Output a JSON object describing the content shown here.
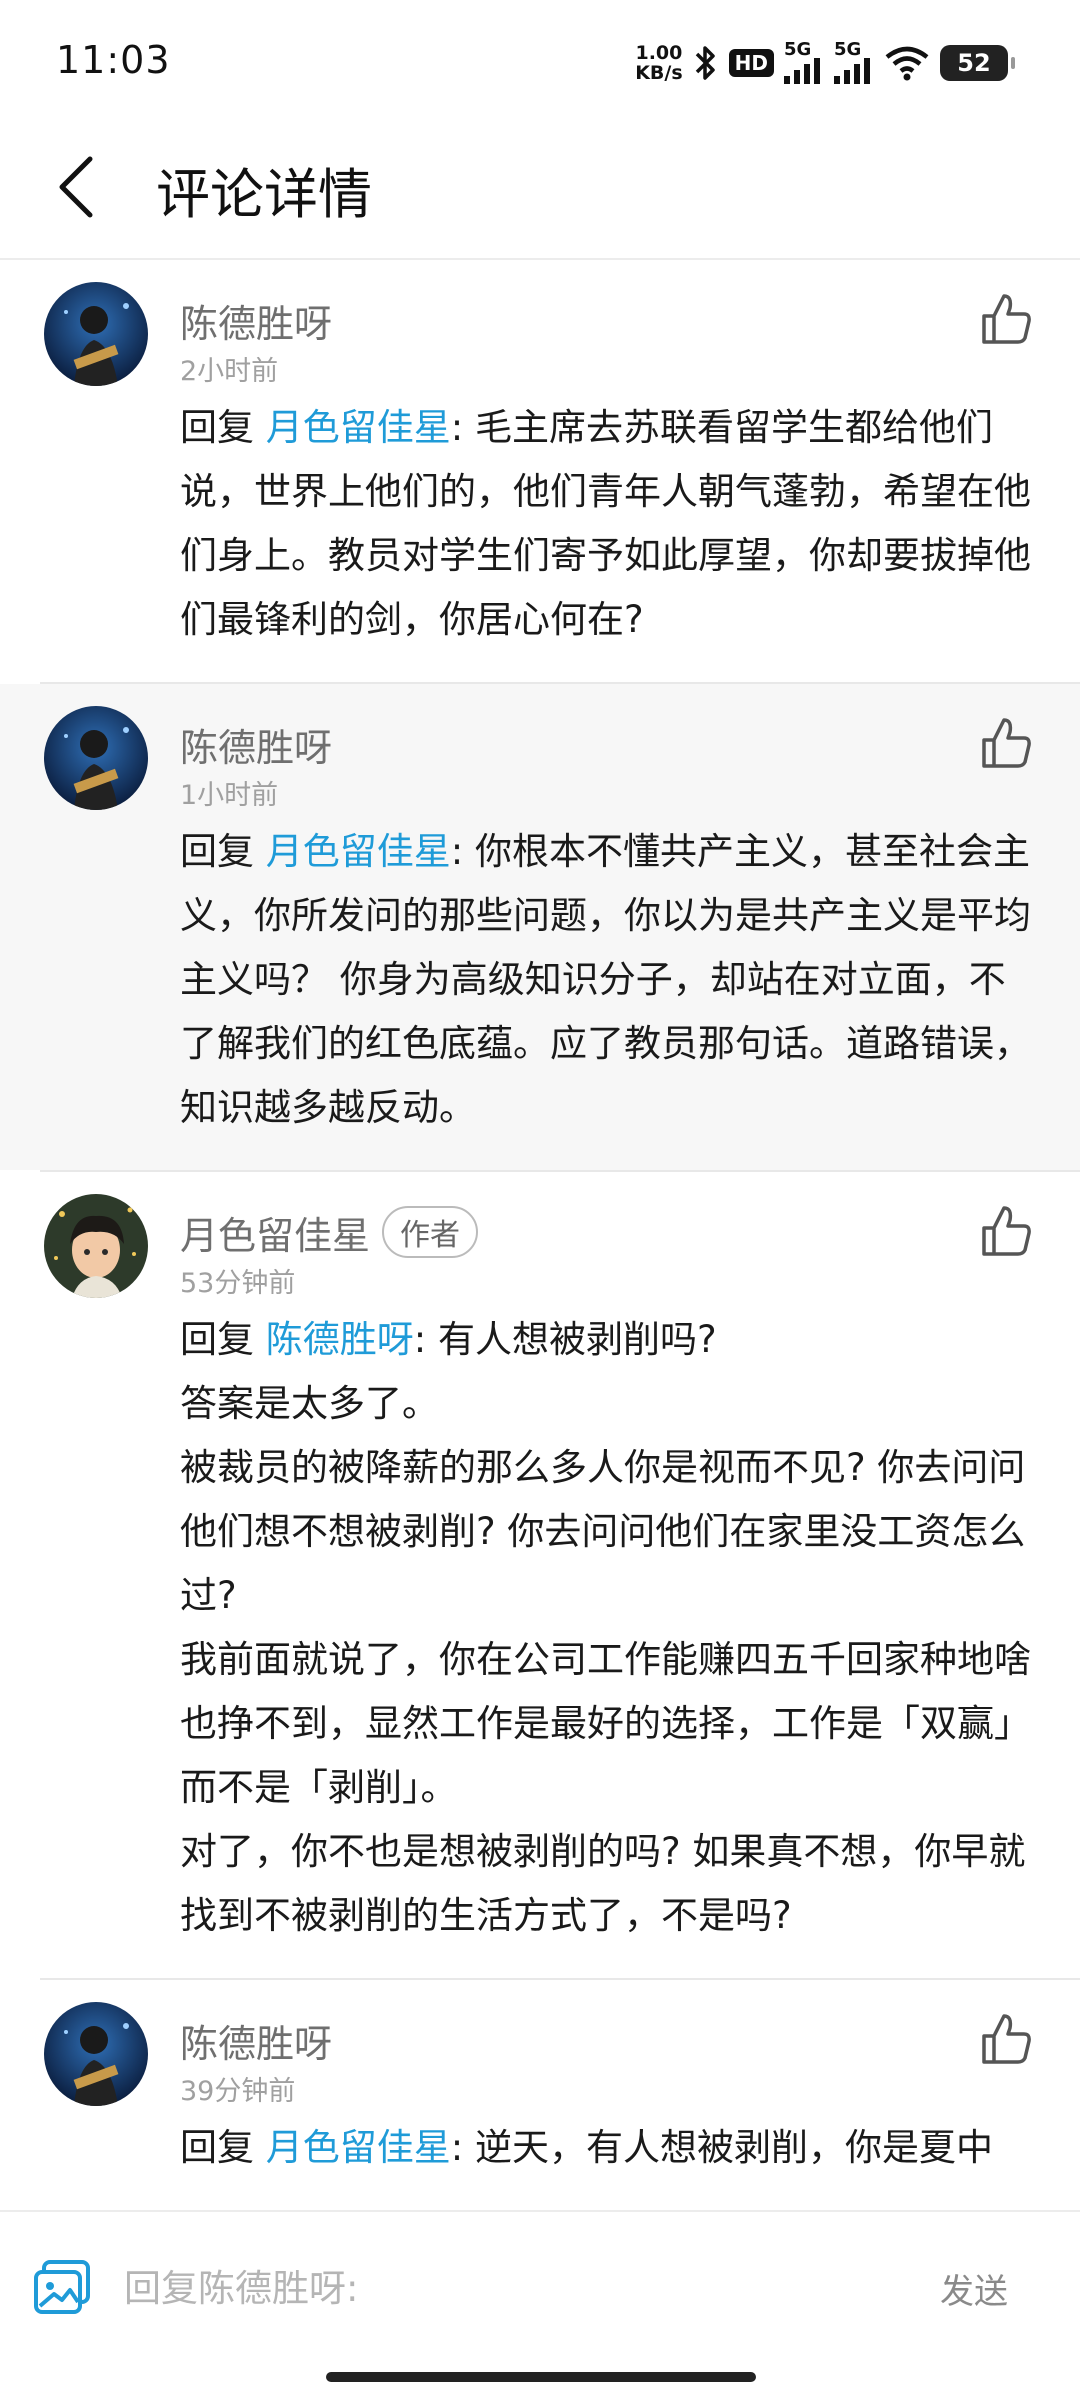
{
  "status_bar": {
    "time": "11:03",
    "net_speed_value": "1.00",
    "net_speed_unit": "KB/s",
    "hd_label": "HD",
    "sig1_label": "5G",
    "sig2_label": "5G",
    "battery": "52"
  },
  "header": {
    "title": "评论详情"
  },
  "comments": [
    {
      "name": "陈德胜呀",
      "time": "2小时前",
      "reply_prefix": "回复 ",
      "reply_to": "月色留佳星",
      "text": ": 毛主席去苏联看留学生都给他们说，世界上他们的，他们青年人朝气蓬勃，希望在他们身上。教员对学生们寄予如此厚望，你却要拔掉他们最锋利的剑，你居心何在?"
    },
    {
      "name": "陈德胜呀",
      "time": "1小时前",
      "reply_prefix": "回复 ",
      "reply_to": "月色留佳星",
      "text": ": 你根本不懂共产主义，甚至社会主义，你所发问的那些问题，你以为是共产主义是平均主义吗？ 你身为高级知识分子，却站在对立面，不了解我们的红色底蕴。应了教员那句话。道路错误，知识越多越反动。"
    },
    {
      "name": "月色留佳星",
      "badge": "作者",
      "time": "53分钟前",
      "reply_prefix": "回复 ",
      "reply_to": "陈德胜呀",
      "text_lines": [
        ": 有人想被剥削吗?",
        "答案是太多了。",
        "被裁员的被降薪的那么多人你是视而不见? 你去问问他们想不想被剥削? 你去问问他们在家里没工资怎么过?",
        "我前面就说了，你在公司工作能赚四五千回家种地啥也挣不到，显然工作是最好的选择，工作是「双赢」而不是「剥削」。",
        "对了，你不也是想被剥削的吗? 如果真不想，你早就找到不被剥削的生活方式了，不是吗?"
      ]
    },
    {
      "name": "陈德胜呀",
      "time": "39分钟前",
      "reply_prefix": "回复 ",
      "reply_to": "月色留佳星",
      "text": ": 逆天，有人想被剥削，你是夏中"
    }
  ],
  "reply_bar": {
    "placeholder": "回复陈德胜呀:",
    "send_label": "发送"
  },
  "colors": {
    "mention": "#1f9bd8",
    "background": "#ffffff",
    "shaded_row": "#f7f7f7"
  },
  "icons": [
    "back-arrow-icon",
    "thumbs-up-icon",
    "image-icon",
    "bluetooth-icon",
    "wifi-icon",
    "signal-icon",
    "battery-icon"
  ]
}
